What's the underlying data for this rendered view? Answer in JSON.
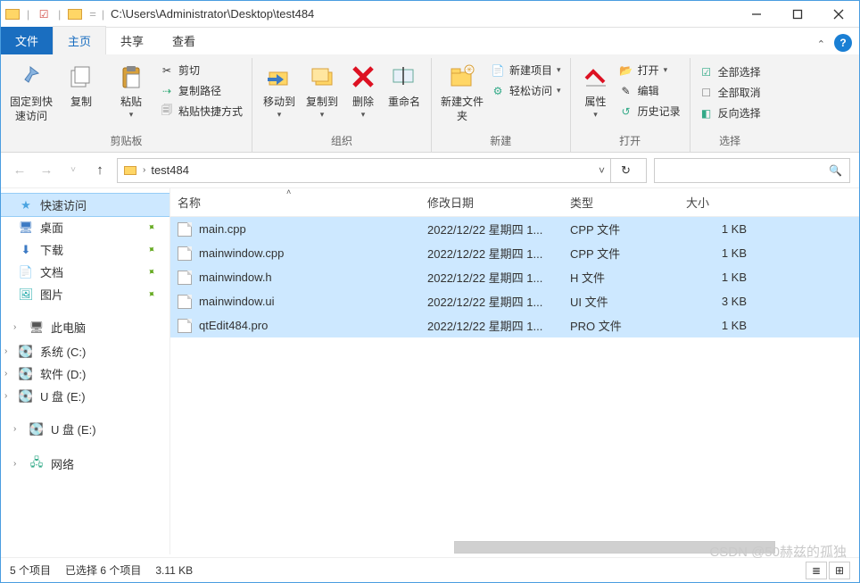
{
  "titlebar": {
    "path": "C:\\Users\\Administrator\\Desktop\\test484"
  },
  "tabs": {
    "file": "文件",
    "home": "主页",
    "share": "共享",
    "view": "查看"
  },
  "ribbon": {
    "clipboard": {
      "pin": "固定到快速访问",
      "copy": "复制",
      "paste": "粘贴",
      "cut": "剪切",
      "copypath": "复制路径",
      "pasteshortcut": "粘贴快捷方式",
      "label": "剪贴板"
    },
    "organize": {
      "moveto": "移动到",
      "copyto": "复制到",
      "delete": "删除",
      "rename": "重命名",
      "label": "组织"
    },
    "new": {
      "newfolder": "新建文件夹",
      "newitem": "新建项目",
      "easyaccess": "轻松访问",
      "label": "新建"
    },
    "open": {
      "properties": "属性",
      "open": "打开",
      "edit": "编辑",
      "history": "历史记录",
      "label": "打开"
    },
    "select": {
      "selectall": "全部选择",
      "selectnone": "全部取消",
      "invert": "反向选择",
      "label": "选择"
    }
  },
  "breadcrumb": {
    "current": "test484"
  },
  "nav": {
    "quick": "快速访问",
    "desktop": "桌面",
    "downloads": "下载",
    "documents": "文档",
    "pictures": "图片",
    "thispc": "此电脑",
    "drive_c": "系统 (C:)",
    "drive_d": "软件 (D:)",
    "drive_e1": "U 盘 (E:)",
    "drive_e2": "U 盘 (E:)",
    "network": "网络"
  },
  "columns": {
    "name": "名称",
    "date": "修改日期",
    "type": "类型",
    "size": "大小"
  },
  "files": [
    {
      "name": "main.cpp",
      "date": "2022/12/22 星期四 1...",
      "type": "CPP 文件",
      "size": "1 KB"
    },
    {
      "name": "mainwindow.cpp",
      "date": "2022/12/22 星期四 1...",
      "type": "CPP 文件",
      "size": "1 KB"
    },
    {
      "name": "mainwindow.h",
      "date": "2022/12/22 星期四 1...",
      "type": "H 文件",
      "size": "1 KB"
    },
    {
      "name": "mainwindow.ui",
      "date": "2022/12/22 星期四 1...",
      "type": "UI 文件",
      "size": "3 KB"
    },
    {
      "name": "qtEdit484.pro",
      "date": "2022/12/22 星期四 1...",
      "type": "PRO 文件",
      "size": "1 KB"
    }
  ],
  "status": {
    "items": "5 个项目",
    "selected": "已选择 6 个项目",
    "size": "3.11 KB"
  },
  "watermark": "CSDN @50赫兹的孤独"
}
